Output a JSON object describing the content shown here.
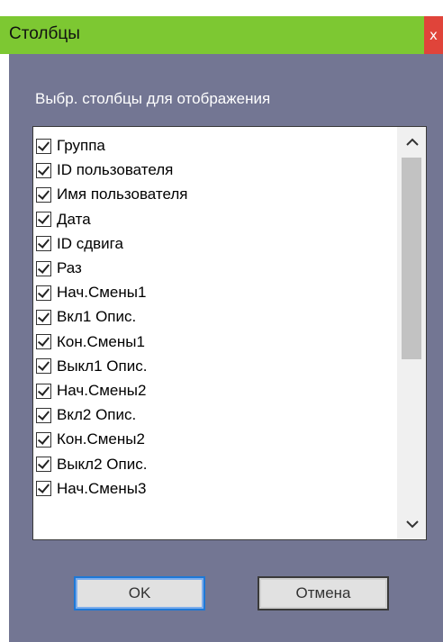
{
  "window": {
    "title": "Столбцы",
    "close_glyph": "x"
  },
  "dialog": {
    "instruction": "Выбр. столбцы для отображения"
  },
  "columns_list": {
    "items": [
      {
        "label": "Группа",
        "checked": true
      },
      {
        "label": "ID пользователя",
        "checked": true
      },
      {
        "label": "Имя пользователя",
        "checked": true
      },
      {
        "label": "Дата",
        "checked": true
      },
      {
        "label": "ID сдвига",
        "checked": true
      },
      {
        "label": "Раз",
        "checked": true
      },
      {
        "label": "Нач.Смены1",
        "checked": true
      },
      {
        "label": "Вкл1 Опис.",
        "checked": true
      },
      {
        "label": "Кон.Смены1",
        "checked": true
      },
      {
        "label": "Выкл1 Опис.",
        "checked": true
      },
      {
        "label": "Нач.Смены2",
        "checked": true
      },
      {
        "label": "Вкл2 Опис.",
        "checked": true
      },
      {
        "label": "Кон.Смены2",
        "checked": true
      },
      {
        "label": "Выкл2 Опис.",
        "checked": true
      },
      {
        "label": "Нач.Смены3",
        "checked": true
      }
    ],
    "scroll_up_glyph": "⌃",
    "scroll_down_glyph": "⌄"
  },
  "buttons": {
    "ok_label": "OK",
    "cancel_label": "Отмена"
  },
  "colors": {
    "title_bar": "#7dc832",
    "close_button": "#e0443a",
    "client_background": "#737693",
    "ok_focus_border": "#1e78d6"
  }
}
